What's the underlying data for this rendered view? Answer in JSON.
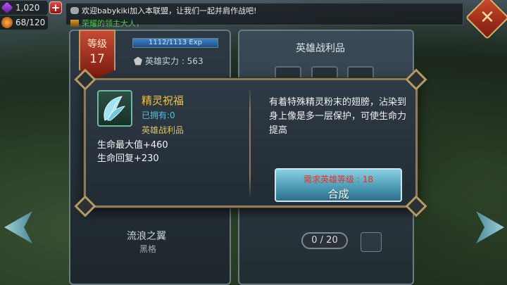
{
  "resources": {
    "gems": "1,020",
    "energy": "68/120"
  },
  "chat": {
    "message1": "欢迎babykiki加入本联盟，让我们一起并肩作战吧!",
    "message2": "荣耀的领主大人，"
  },
  "hero_panel": {
    "level_label": "等级",
    "level_value": "17",
    "exp_text": "1112/1113 Exp",
    "exp_progress": 0.999,
    "power_text": "英雄实力 : 563",
    "wing_name": "流浪之翼",
    "wing_sub": "黑格"
  },
  "spoils_panel": {
    "title": "英雄战利品",
    "counter": "0 / 20"
  },
  "tooltip": {
    "item_name": "精灵祝福",
    "owned": "已拥有:0",
    "category": "英雄战利品",
    "stat_hp": "生命最大值+460",
    "stat_regen": "生命回复+230",
    "description": "有着特殊精灵粉末的翅膀，沾染到身上像是多一层保护，可使生命力提高",
    "requirement": "需求英雄等级 : 18",
    "craft_label": "合成"
  },
  "colors": {
    "item_name": "#f0c24a",
    "owned": "#52c1de",
    "requirement": "#e23127",
    "craft_button": "#4e9bb6"
  },
  "icons": [
    "gem-icon",
    "energy-icon",
    "plus-icon",
    "chat-bubble-icon",
    "close-icon",
    "wing-icon",
    "power-icon",
    "left-arrow-icon",
    "right-arrow-icon"
  ]
}
